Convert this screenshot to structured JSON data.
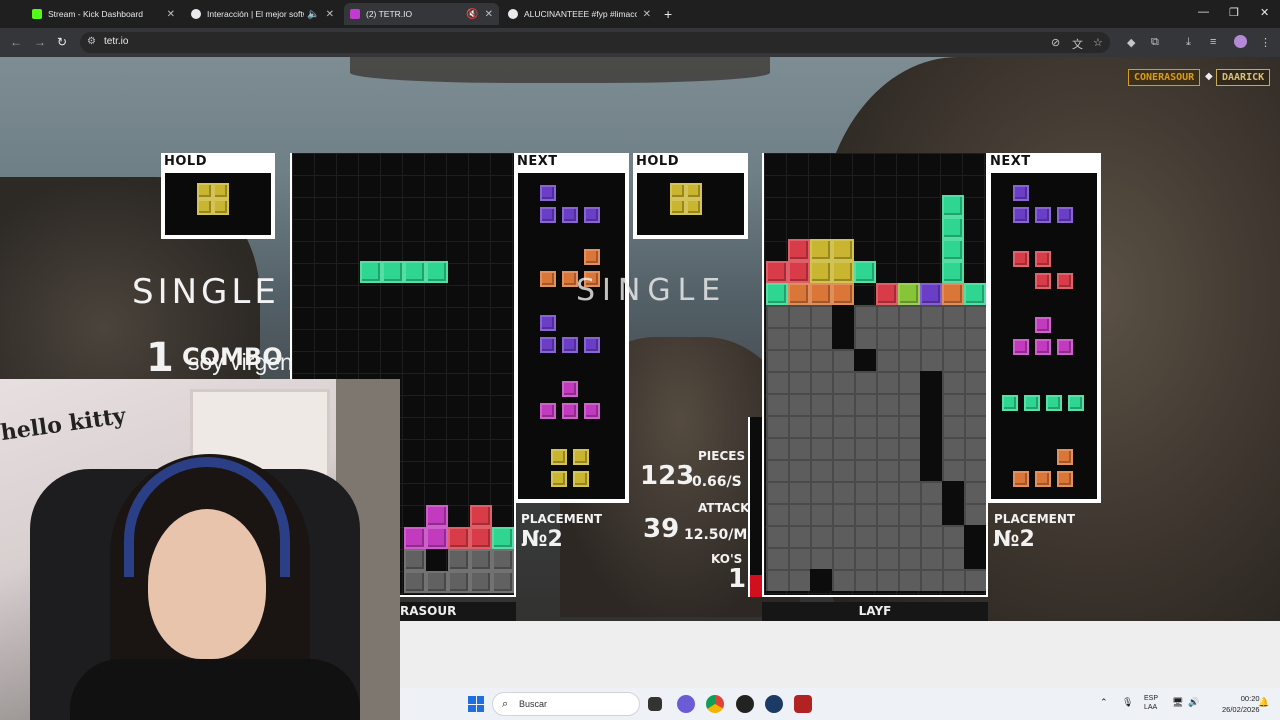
{
  "browser": {
    "tabs": [
      {
        "title": "Stream - Kick Dashboard",
        "favicon": "kick-icon",
        "color": "#53fc18"
      },
      {
        "title": "Interacción | El mejor softw",
        "favicon": "diamond-icon",
        "color": "#e8eaed"
      },
      {
        "title": "(2) TETR.IO",
        "favicon": "tetrio-icon",
        "color": "#c03bd0"
      },
      {
        "title": "ALUCINANTEEE #fyp #limaco |",
        "favicon": "tiktok-icon",
        "color": "#e8eaed"
      }
    ],
    "url": "tetr.io"
  },
  "game": {
    "badges": {
      "left": "CONERASOUR",
      "right": "DAARICK"
    },
    "left": {
      "hold_label": "HOLD",
      "next_label": "NEXT",
      "clear_text": "SINGLE",
      "combo_number": "1",
      "combo_label": "COMBO",
      "placement_label": "PLACEMENT",
      "placement_value": "№2",
      "name": "RASOUR"
    },
    "right": {
      "hold_label": "HOLD",
      "next_label": "NEXT",
      "clear_text": "SINGLE",
      "pieces_label": "PIECES",
      "pieces_value": "123",
      "pieces_rate": "0.66/S",
      "attack_label": "ATTACK",
      "attack_value": "39",
      "attack_rate": "12.50/M",
      "kos_label": "KO'S",
      "kos_value": "1",
      "placement_label": "PLACEMENT",
      "placement_value": "№2",
      "name": "LAYF"
    }
  },
  "stream": {
    "overlay_text": "soy virgen",
    "webcam_sign": "hello kitty"
  },
  "taskbar": {
    "search_placeholder": "Buscar",
    "lang_top": "ESP",
    "lang_bottom": "LAA",
    "time": "00:20",
    "date": "26/02/2026"
  }
}
